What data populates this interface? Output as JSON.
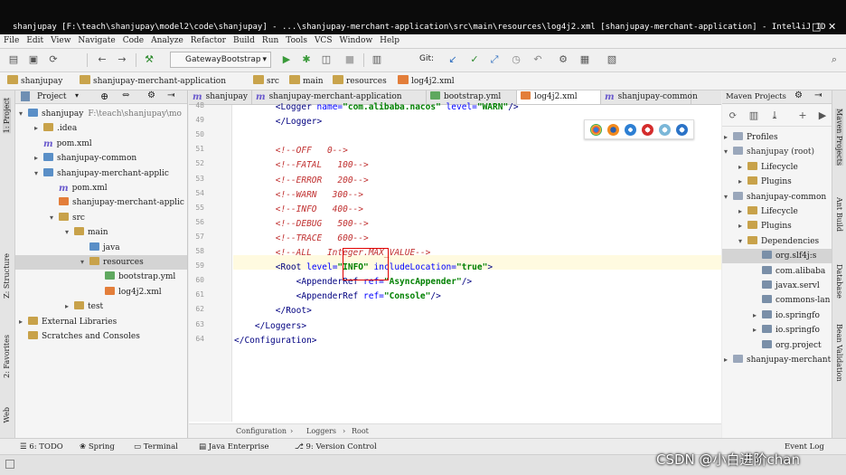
{
  "titlebar": {
    "text": "shanjupay [F:\\teach\\shanjupay\\model2\\code\\shanjupay] - ...\\shanjupay-merchant-application\\src\\main\\resources\\log4j2.xml [shanjupay-merchant-application] - IntelliJ IDEA (Administrator)",
    "min": "–",
    "max": "□",
    "close": "✕"
  },
  "menu": [
    "File",
    "Edit",
    "View",
    "Navigate",
    "Code",
    "Analyze",
    "Refactor",
    "Build",
    "Run",
    "Tools",
    "VCS",
    "Window",
    "Help"
  ],
  "toolbar": {
    "run_config": "GatewayBootstrap",
    "git_label": "Git:"
  },
  "breadcrumbs": [
    "shanjupay",
    "shanjupay-merchant-application",
    "src",
    "main",
    "resources",
    "log4j2.xml"
  ],
  "project_panel": {
    "title": "Project",
    "tree": [
      {
        "label": "shanjupay",
        "extra": "F:\\teach\\shanjupay\\mo",
        "depth": 0,
        "arrow": "▾",
        "icon": "modf"
      },
      {
        "label": ".idea",
        "depth": 1,
        "arrow": "▸",
        "icon": "fold"
      },
      {
        "label": "pom.xml",
        "depth": 1,
        "arrow": "",
        "icon": "mvn"
      },
      {
        "label": "shanjupay-common",
        "depth": 1,
        "arrow": "▸",
        "icon": "modf"
      },
      {
        "label": "shanjupay-merchant-applic",
        "depth": 1,
        "arrow": "▾",
        "icon": "modf"
      },
      {
        "label": "pom.xml",
        "depth": 2,
        "arrow": "",
        "icon": "mvn"
      },
      {
        "label": "shanjupay-merchant-applic",
        "depth": 2,
        "arrow": "",
        "icon": "xml"
      },
      {
        "label": "src",
        "depth": 2,
        "arrow": "▾",
        "icon": "fold"
      },
      {
        "label": "main",
        "depth": 3,
        "arrow": "▾",
        "icon": "fold"
      },
      {
        "label": "java",
        "depth": 4,
        "arrow": "",
        "icon": "modf"
      },
      {
        "label": "resources",
        "depth": 4,
        "arrow": "▾",
        "icon": "fold",
        "selected": true
      },
      {
        "label": "bootstrap.yml",
        "depth": 5,
        "arrow": "",
        "icon": "yml"
      },
      {
        "label": "log4j2.xml",
        "depth": 5,
        "arrow": "",
        "icon": "xml"
      },
      {
        "label": "test",
        "depth": 3,
        "arrow": "▸",
        "icon": "fold"
      },
      {
        "label": "External Libraries",
        "depth": 0,
        "arrow": "▸",
        "icon": "fold"
      },
      {
        "label": "Scratches and Consoles",
        "depth": 0,
        "arrow": "",
        "icon": "fold"
      }
    ]
  },
  "tabs": [
    "shanjupay",
    "shanjupay-merchant-application",
    "bootstrap.yml",
    "log4j2.xml",
    "shanjupay-common"
  ],
  "editor": {
    "line_numbers": [
      "48",
      "49",
      "50",
      "51",
      "52",
      "53",
      "54",
      "55",
      "56",
      "57",
      "58",
      "59",
      "60",
      "61",
      "62",
      "63",
      "64"
    ],
    "lines": [
      {
        "parts": [
          {
            "t": "        ",
            "c": ""
          },
          {
            "t": "<Logger ",
            "c": "tg"
          },
          {
            "t": "name=",
            "c": "at"
          },
          {
            "t": "\"com.alibaba.nacos\"",
            "c": "vl"
          },
          {
            "t": " level=",
            "c": "at"
          },
          {
            "t": "\"WARN\"",
            "c": "vl"
          },
          {
            "t": "/>",
            "c": "tg"
          }
        ]
      },
      {
        "parts": [
          {
            "t": "        ",
            "c": ""
          },
          {
            "t": "</Logger>",
            "c": "tg"
          }
        ]
      },
      {
        "parts": []
      },
      {
        "parts": [
          {
            "t": "        ",
            "c": ""
          },
          {
            "t": "<!--OFF   0-->",
            "c": "cmt"
          }
        ]
      },
      {
        "parts": [
          {
            "t": "        ",
            "c": ""
          },
          {
            "t": "<!--FATAL   100-->",
            "c": "cmt"
          }
        ]
      },
      {
        "parts": [
          {
            "t": "        ",
            "c": ""
          },
          {
            "t": "<!--ERROR   200-->",
            "c": "cmt"
          }
        ]
      },
      {
        "parts": [
          {
            "t": "        ",
            "c": ""
          },
          {
            "t": "<!--WARN   300-->",
            "c": "cmt"
          }
        ]
      },
      {
        "parts": [
          {
            "t": "        ",
            "c": ""
          },
          {
            "t": "<!--INFO   400-->",
            "c": "cmt"
          }
        ]
      },
      {
        "parts": [
          {
            "t": "        ",
            "c": ""
          },
          {
            "t": "<!--DEBUG   500-->",
            "c": "cmt"
          }
        ]
      },
      {
        "parts": [
          {
            "t": "        ",
            "c": ""
          },
          {
            "t": "<!--TRACE   600-->",
            "c": "cmt"
          }
        ]
      },
      {
        "parts": [
          {
            "t": "        ",
            "c": ""
          },
          {
            "t": "<!--ALL   Integer.MAX_VALUE-->",
            "c": "cmt"
          }
        ]
      },
      {
        "parts": [
          {
            "t": "        ",
            "c": ""
          },
          {
            "t": "<Root ",
            "c": "tg"
          },
          {
            "t": "level=",
            "c": "at"
          },
          {
            "t": "\"INFO\"",
            "c": "vl"
          },
          {
            "t": " includeLocation=",
            "c": "at"
          },
          {
            "t": "\"true\"",
            "c": "vl"
          },
          {
            "t": ">",
            "c": "tg"
          }
        ]
      },
      {
        "parts": [
          {
            "t": "            ",
            "c": ""
          },
          {
            "t": "<AppenderRef ",
            "c": "tg"
          },
          {
            "t": "ref=",
            "c": "at"
          },
          {
            "t": "\"AsyncAppender\"",
            "c": "vl"
          },
          {
            "t": "/>",
            "c": "tg"
          }
        ]
      },
      {
        "parts": [
          {
            "t": "            ",
            "c": ""
          },
          {
            "t": "<AppenderRef ",
            "c": "tg"
          },
          {
            "t": "ref=",
            "c": "at"
          },
          {
            "t": "\"Console\"",
            "c": "vl"
          },
          {
            "t": "/>",
            "c": "tg"
          }
        ]
      },
      {
        "parts": [
          {
            "t": "        ",
            "c": ""
          },
          {
            "t": "</Root>",
            "c": "tg"
          }
        ]
      },
      {
        "parts": [
          {
            "t": "    ",
            "c": ""
          },
          {
            "t": "</Loggers>",
            "c": "tg"
          }
        ]
      },
      {
        "parts": [
          {
            "t": "</Configuration>",
            "c": "tg"
          }
        ]
      }
    ],
    "breadcrumb": [
      "Configuration",
      "Loggers",
      "Root"
    ]
  },
  "maven_panel": {
    "title": "Maven Projects",
    "tree": [
      {
        "label": "Profiles",
        "depth": 0,
        "arrow": "▸"
      },
      {
        "label": "shanjupay (root)",
        "depth": 0,
        "arrow": "▾"
      },
      {
        "label": "Lifecycle",
        "depth": 1,
        "arrow": "▸"
      },
      {
        "label": "Plugins",
        "depth": 1,
        "arrow": "▸"
      },
      {
        "label": "shanjupay-common",
        "depth": 0,
        "arrow": "▾"
      },
      {
        "label": "Lifecycle",
        "depth": 1,
        "arrow": "▸"
      },
      {
        "label": "Plugins",
        "depth": 1,
        "arrow": "▸"
      },
      {
        "label": "Dependencies",
        "depth": 1,
        "arrow": "▾"
      },
      {
        "label": "org.slf4j:s",
        "depth": 2,
        "arrow": "",
        "selected": true
      },
      {
        "label": "com.alibaba",
        "depth": 2,
        "arrow": ""
      },
      {
        "label": "javax.servl",
        "depth": 2,
        "arrow": ""
      },
      {
        "label": "commons-lan",
        "depth": 2,
        "arrow": ""
      },
      {
        "label": "io.springfo",
        "depth": 2,
        "arrow": "▸"
      },
      {
        "label": "io.springfo",
        "depth": 2,
        "arrow": "▸"
      },
      {
        "label": "org.project",
        "depth": 2,
        "arrow": ""
      },
      {
        "label": "shanjupay-merchant",
        "depth": 0,
        "arrow": "▸"
      }
    ]
  },
  "left_strip": [
    "1: Project",
    "Z: Structure",
    "2: Favorites",
    "Web"
  ],
  "right_strip": [
    "Maven Projects",
    "Ant Build",
    "Database",
    "Bean Validation"
  ],
  "bottom_tabs": [
    "6: TODO",
    "Spring",
    "Terminal",
    "Java Enterprise",
    "9: Version Control"
  ],
  "event_log": "Event Log",
  "watermark": "CSDN @小白进阶chan"
}
